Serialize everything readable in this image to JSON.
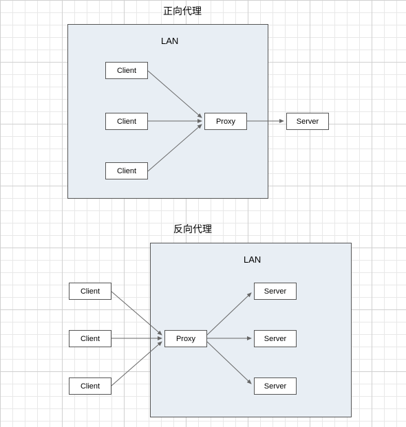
{
  "diagram1": {
    "title": "正向代理",
    "lan_label": "LAN",
    "client1": "Client",
    "client2": "Client",
    "client3": "Client",
    "proxy": "Proxy",
    "server": "Server"
  },
  "diagram2": {
    "title": "反向代理",
    "lan_label": "LAN",
    "client1": "Client",
    "client2": "Client",
    "client3": "Client",
    "proxy": "Proxy",
    "server1": "Server",
    "server2": "Server",
    "server3": "Server"
  }
}
